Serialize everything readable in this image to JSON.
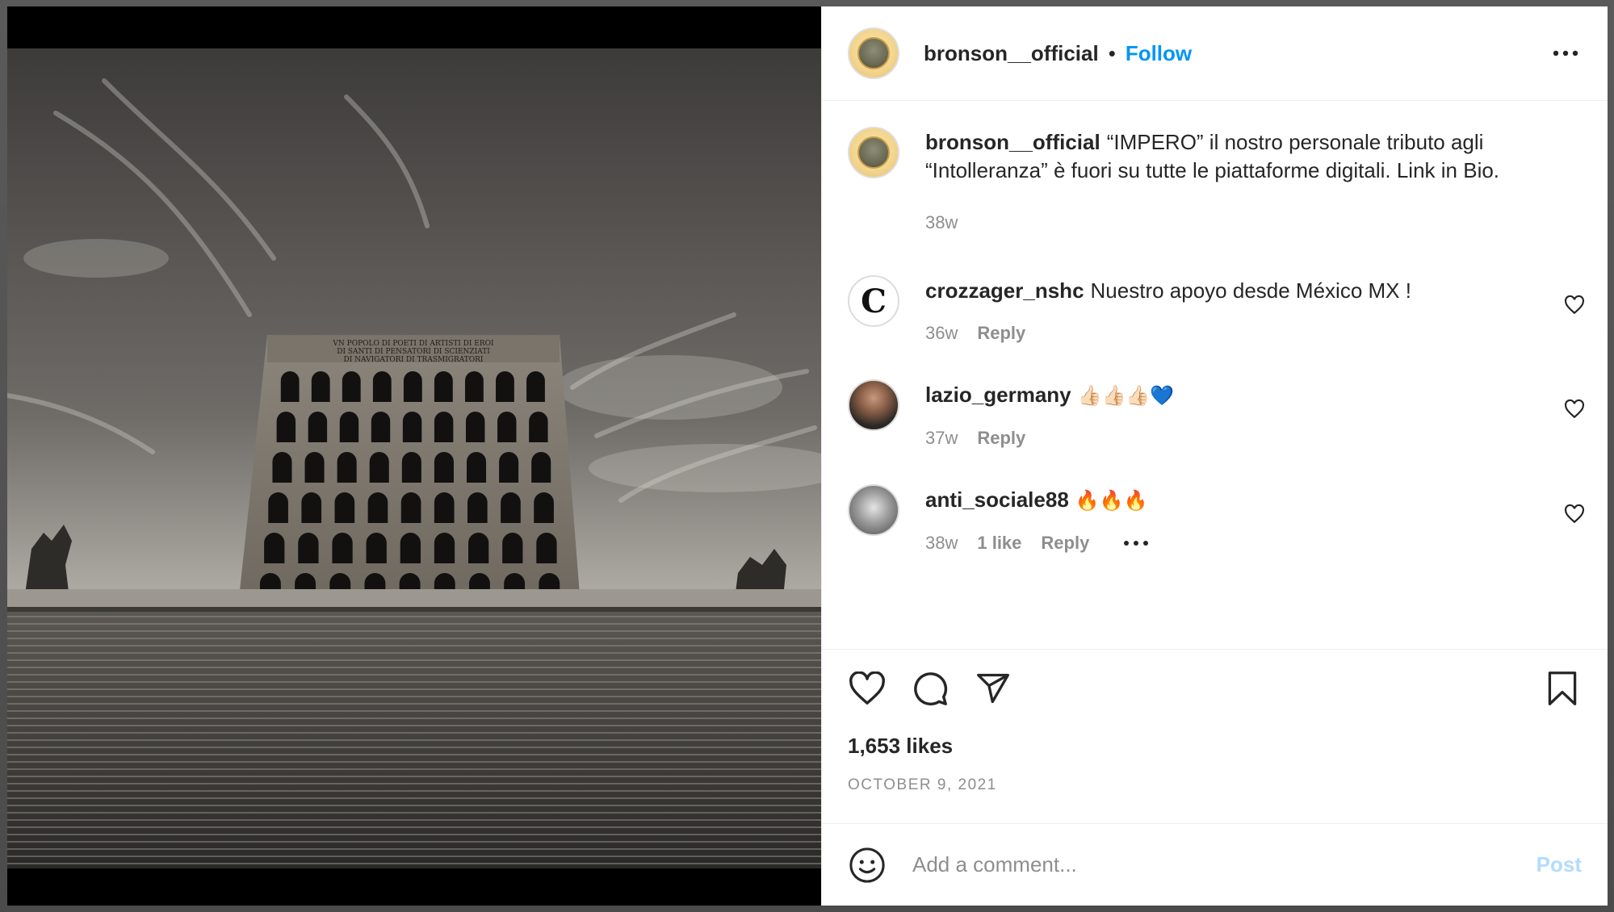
{
  "post": {
    "author": "bronson__official",
    "separator": "•",
    "follow_label": "Follow",
    "more_label": "More options"
  },
  "caption": {
    "username": "bronson__official",
    "text": "“IMPERO” il nostro personale tributo agli “Intolleranza” è fuori su tutte le piattaforme digitali. Link in Bio.",
    "time": "38w"
  },
  "comments": [
    {
      "username": "crozzager_nshc",
      "text": "Nuestro apoyo desde México MX !",
      "time": "36w",
      "likes": "",
      "reply": "Reply",
      "emoji": ""
    },
    {
      "username": "lazio_germany",
      "text": "",
      "emoji": "👍🏻👍🏻👍🏻💙",
      "time": "37w",
      "likes": "",
      "reply": "Reply"
    },
    {
      "username": "anti_sociale88",
      "text": "",
      "emoji": "🔥🔥🔥",
      "time": "38w",
      "likes": "1 like",
      "reply": "Reply"
    }
  ],
  "engagement": {
    "likes": "1,653 likes",
    "date": "OCTOBER 9, 2021"
  },
  "composer": {
    "placeholder": "Add a comment...",
    "post_label": "Post"
  },
  "photo": {
    "inscription_lines": [
      "VN POPOLO DI POETI DI ARTISTI DI EROI",
      "DI SANTI DI PENSATORI DI SCIENZIATI",
      "DI NAVIGATORI DI TRASMIGRATORI"
    ]
  },
  "colors": {
    "accent": "#0095f6",
    "post_disabled": "#b3dbff",
    "text": "#262626",
    "secondary": "#8e8e8e"
  },
  "icons": {
    "like": "heart-icon",
    "comment": "comment-bubble-icon",
    "share": "paper-plane-icon",
    "save": "bookmark-icon",
    "emoji": "smiley-icon",
    "more": "ellipsis-icon"
  }
}
